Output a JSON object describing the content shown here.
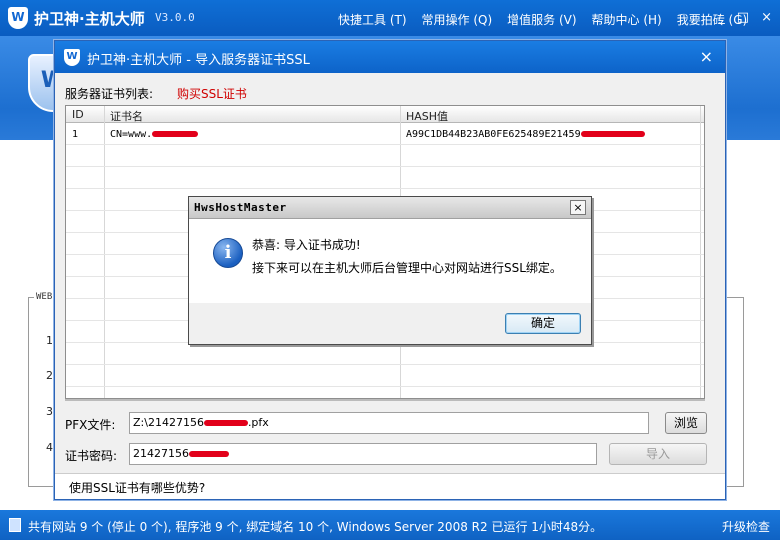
{
  "app": {
    "title": "护卫神·主机大师",
    "version": "V3.0.0",
    "menu": [
      "快捷工具 (T)",
      "常用操作 (Q)",
      "增值服务 (V)",
      "帮助中心 (H)",
      "我要拍砖 (G)"
    ],
    "window_controls": [
      "_",
      "□",
      "×"
    ]
  },
  "background": {
    "group_label": "WEB",
    "row_numbers": [
      "1",
      "2",
      "3",
      "4"
    ]
  },
  "dialog": {
    "title": "护卫神·主机大师 - 导入服务器证书SSL",
    "list_label": "服务器证书列表:",
    "buy_link": "购买SSL证书",
    "table": {
      "columns": [
        "ID",
        "证书名",
        "HASH值"
      ],
      "rows": [
        {
          "id": "1",
          "name": "CN=www.",
          "hash": "A99C1DB44B23AB0FE625489E21459"
        }
      ]
    },
    "pfx_label": "PFX文件:",
    "pfx_value": "Z:\\21427156",
    "pfx_suffix": ".pfx",
    "browse_button": "浏览",
    "password_label": "证书密码:",
    "password_value": "21427156",
    "import_button": "导入",
    "advantages_text": "使用SSL证书有哪些优势?"
  },
  "messagebox": {
    "title": "HwsHostMaster",
    "close": "×",
    "icon": "info-icon",
    "line1": "恭喜: 导入证书成功!",
    "line2": "接下来可以在主机大师后台管理中心对网站进行SSL绑定。",
    "ok_button": "确定"
  },
  "statusbar": {
    "text": "共有网站 9 个 (停止 0 个), 程序池 9 个, 绑定域名 10 个, Windows Server 2008 R2 已运行 1小时48分。",
    "upgrade": "升级检查"
  }
}
